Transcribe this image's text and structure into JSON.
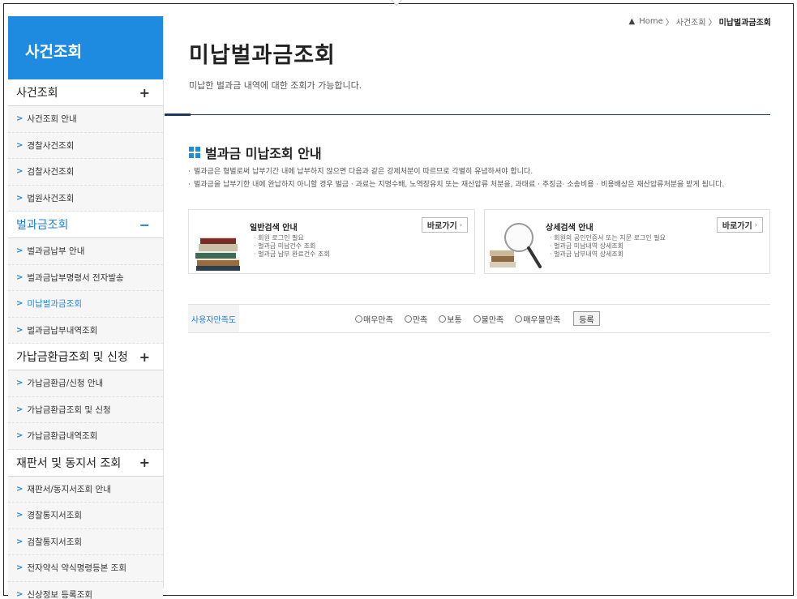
{
  "breadcrumb": {
    "home": "Home",
    "parent": "사건조회",
    "current": "미납벌과금조회",
    "sep": "〉"
  },
  "sidebar": {
    "title": "사건조회",
    "sections": [
      {
        "label": "사건조회",
        "symbol": "+",
        "active": false,
        "items": [
          "사건조회 안내",
          "경찰사건조회",
          "검찰사건조회",
          "법원사건조회"
        ]
      },
      {
        "label": "벌과금조회",
        "symbol": "−",
        "active": true,
        "items": [
          "벌과금납부 안내",
          "벌과금납부명령서 전자발송",
          "미납벌과금조회",
          "벌과금납부내역조회"
        ]
      },
      {
        "label": "가납금환급조회 및 신청",
        "symbol": "+",
        "active": false,
        "items": [
          "가납금환급/신청 안내",
          "가납금환급조회 및 신청",
          "가납금환급내역조회"
        ]
      },
      {
        "label": "재판서 및 동지서 조회",
        "symbol": "+",
        "active": false,
        "items": [
          "재판서/동지서조회 안내",
          "경찰통지서조회",
          "검찰통지서조회",
          "전자약식 약식명령등본 조회",
          "신상정보 등록조회"
        ]
      }
    ]
  },
  "main": {
    "title": "미납벌과금조회",
    "description": "미납한 벌과금 내역에 대한 조회가 가능합니다.",
    "section_title": "벌과금 미납조회 안내",
    "notes": [
      "벌과금은 형벌로써 납부기간 내에 납부하지 않으면 다음과 같은 강제처분이 따르므로 각별히 유념하셔야 합니다.",
      "벌과금을 납부기한 내에 완납하지 아니할 경우 벌금 · 과료는 지명수배, 노역장유치 또는 재산압류 처분을, 과태료 · 추징금· 소송비용 · 비용배상은 재산압류처분을 받게 됩니다."
    ],
    "cards": [
      {
        "title": "일반검색 안내",
        "button": "바로가기",
        "lines": [
          "회원 로그인 필요",
          "벌과금 미납건수 조회",
          "벌과금 납부 완료건수 조회"
        ]
      },
      {
        "title": "상세검색 안내",
        "button": "바로가기",
        "lines": [
          "회원의 공인인증서 또는 지문 로그인 필요",
          "벌과금 미납내역 상세조회",
          "벌과금 납부내역 상세조회"
        ]
      }
    ]
  },
  "survey": {
    "label": "사용자만족도",
    "options": [
      "매우만족",
      "만족",
      "보통",
      "불만족",
      "매우불만족"
    ],
    "submit": "등록"
  },
  "colors": {
    "accent": "#1f8be0",
    "title_line": "#1d3a5c"
  }
}
